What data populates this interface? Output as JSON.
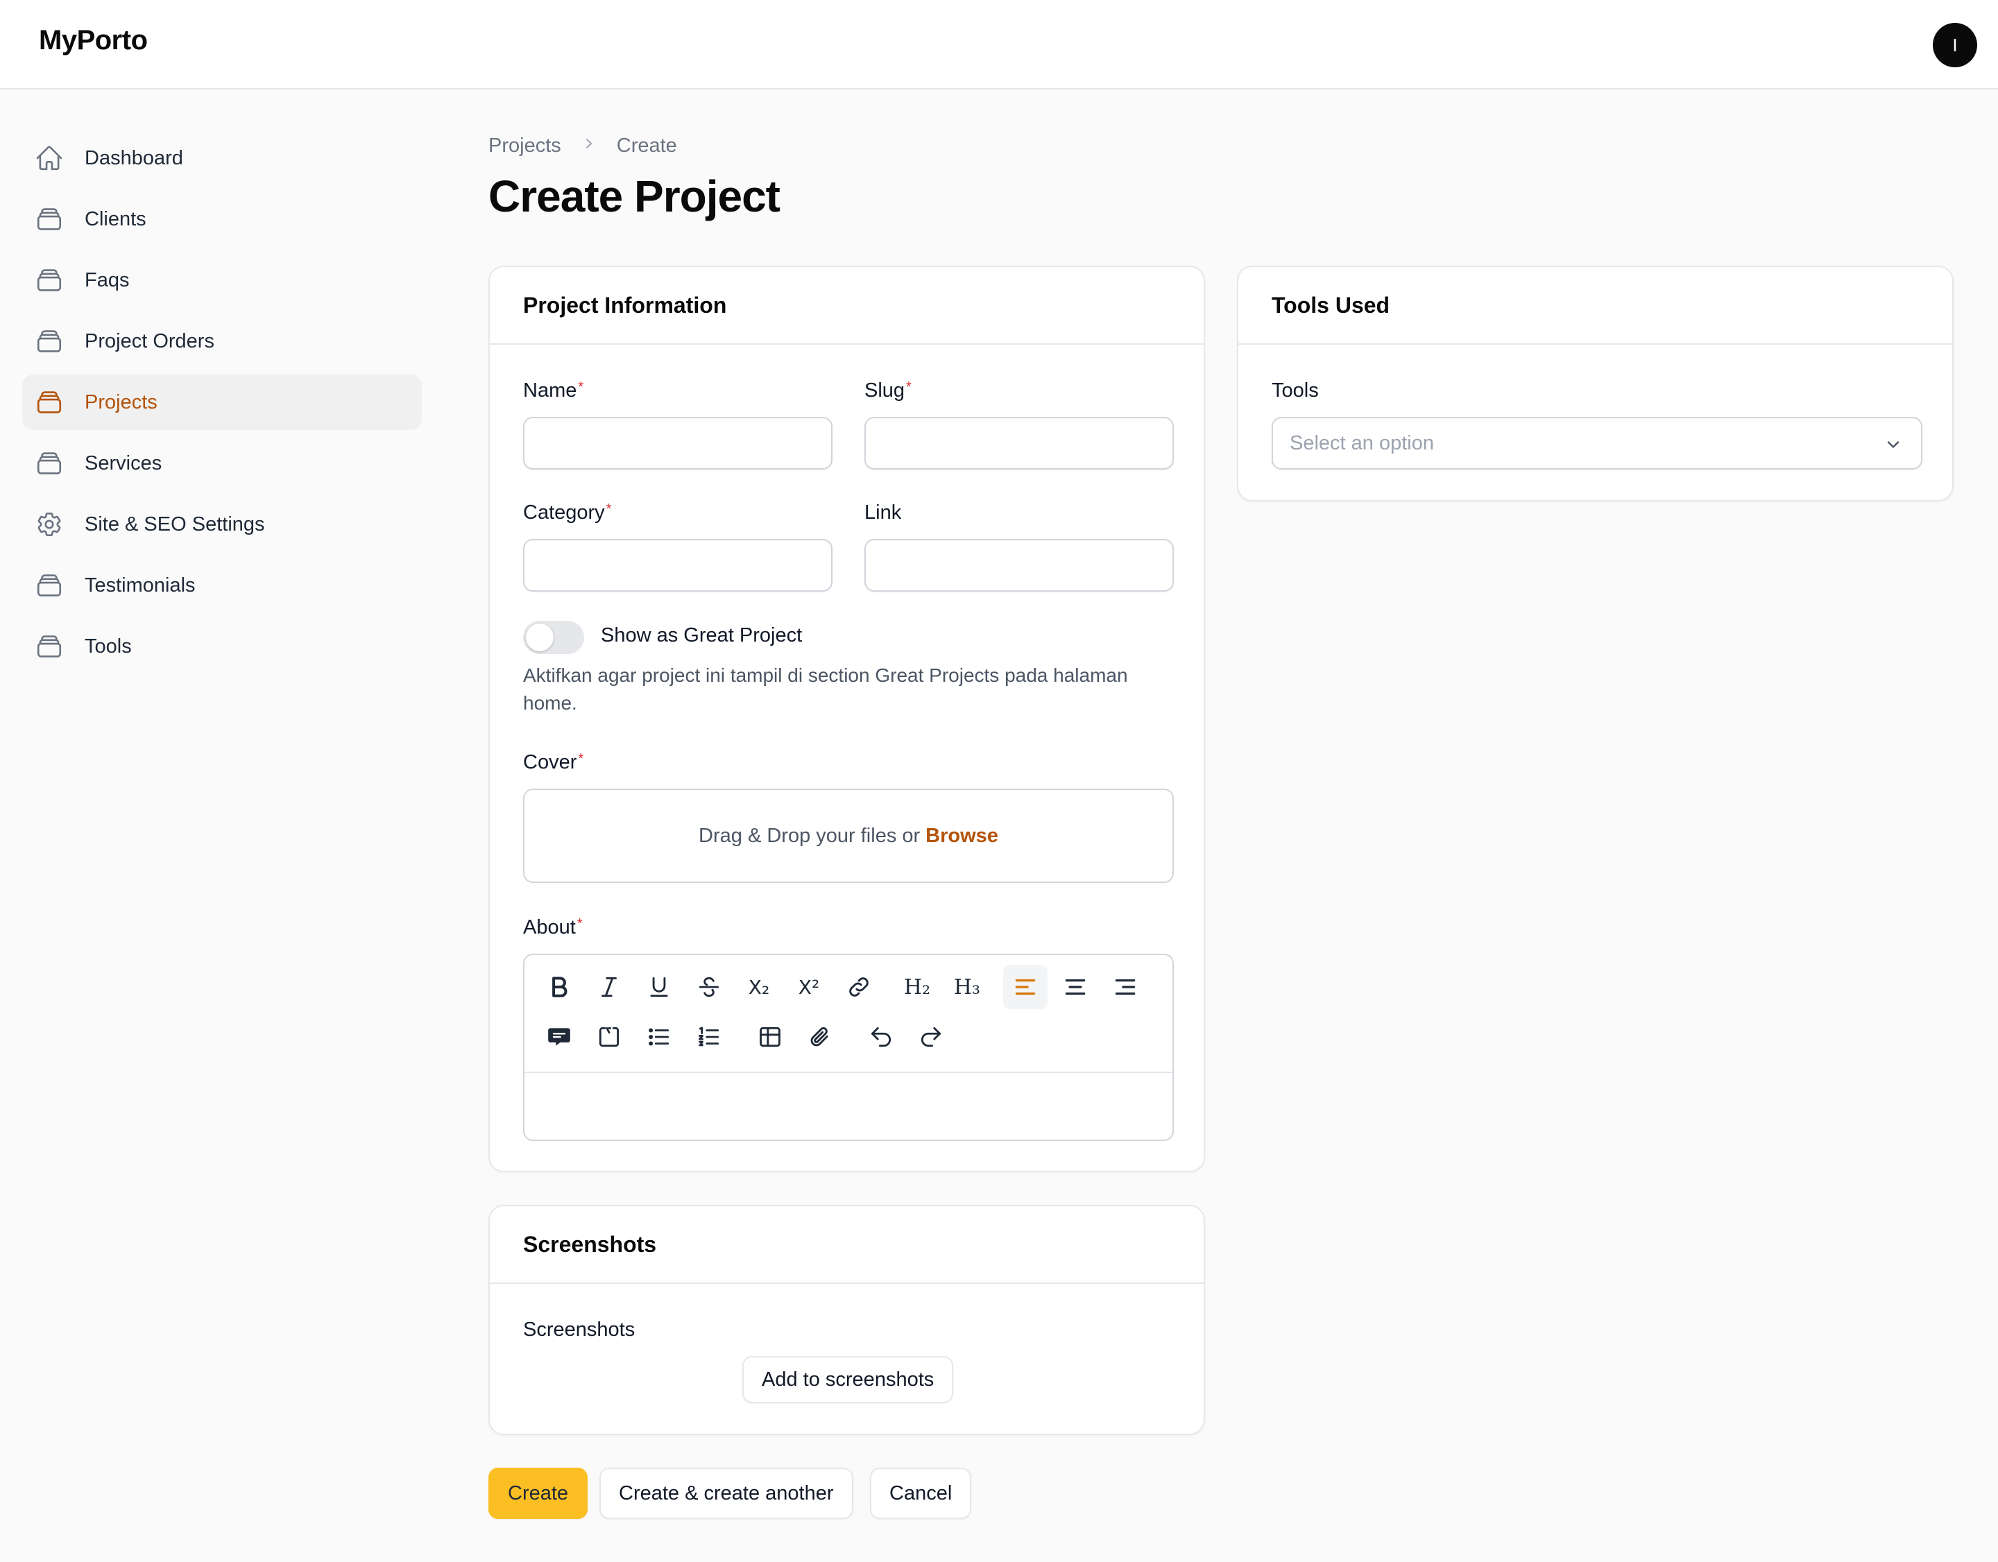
{
  "app": {
    "brand": "MyPorto",
    "avatar_initial": "I"
  },
  "sidebar": {
    "items": [
      {
        "label": "Dashboard",
        "icon": "home-icon",
        "active": false
      },
      {
        "label": "Clients",
        "icon": "rectangle-stack-icon",
        "active": false
      },
      {
        "label": "Faqs",
        "icon": "rectangle-stack-icon",
        "active": false
      },
      {
        "label": "Project Orders",
        "icon": "rectangle-stack-icon",
        "active": false
      },
      {
        "label": "Projects",
        "icon": "rectangle-stack-icon",
        "active": true
      },
      {
        "label": "Services",
        "icon": "rectangle-stack-icon",
        "active": false
      },
      {
        "label": "Site & SEO Settings",
        "icon": "cog-icon",
        "active": false
      },
      {
        "label": "Testimonials",
        "icon": "rectangle-stack-icon",
        "active": false
      },
      {
        "label": "Tools",
        "icon": "rectangle-stack-icon",
        "active": false
      }
    ]
  },
  "breadcrumb": {
    "items": [
      "Projects",
      "Create"
    ]
  },
  "page": {
    "title": "Create Project"
  },
  "project_info": {
    "heading": "Project Information",
    "name_label": "Name",
    "slug_label": "Slug",
    "category_label": "Category",
    "link_label": "Link",
    "name_value": "",
    "slug_value": "",
    "category_value": "",
    "link_value": "",
    "great_toggle_label": "Show as Great Project",
    "great_toggle_on": false,
    "great_helper": "Aktifkan agar project ini tampil di section Great Projects pada halaman home.",
    "cover_label": "Cover",
    "dropzone_text": "Drag & Drop your files or",
    "dropzone_browse": "Browse",
    "about_label": "About",
    "toolbar": {
      "h2": "H₂",
      "h3": "H₃",
      "subscript": "X₂",
      "superscript": "X²"
    }
  },
  "tools_used": {
    "heading": "Tools Used",
    "tools_label": "Tools",
    "select_placeholder": "Select an option"
  },
  "screenshots": {
    "heading": "Screenshots",
    "field_label": "Screenshots",
    "add_button": "Add to screenshots"
  },
  "actions": {
    "create": "Create",
    "create_another": "Create & create another",
    "cancel": "Cancel"
  },
  "colors": {
    "accent": "#b45309",
    "primary_button": "#fbbf24",
    "required": "#dc2626",
    "active_toolbar": "#d97706"
  }
}
